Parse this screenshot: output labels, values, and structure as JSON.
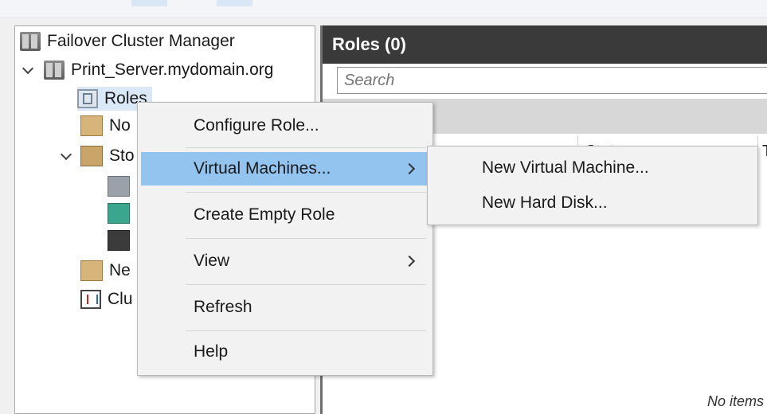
{
  "tree": {
    "items": [
      {
        "label": "Failover Cluster Manager",
        "icon": "cluster-manager-icon"
      },
      {
        "label": "Print_Server.mydomain.org",
        "icon": "cluster-icon"
      },
      {
        "label": "Roles",
        "icon": "roles-icon"
      },
      {
        "label": "No",
        "icon": "nodes-icon"
      },
      {
        "label": "Sto",
        "icon": "storage-icon"
      },
      {
        "label": "",
        "icon": "disks-icon"
      },
      {
        "label": "",
        "icon": "pools-icon"
      },
      {
        "label": "",
        "icon": "enclosures-icon"
      },
      {
        "label": "Ne",
        "icon": "networks-icon"
      },
      {
        "label": "Clu",
        "icon": "cluster-events-icon"
      }
    ]
  },
  "roles_pane": {
    "title": "Roles (0)",
    "search_placeholder": "Search",
    "columns": [
      "Status",
      "T"
    ],
    "empty_message": "No items"
  },
  "context_menu": {
    "items": [
      {
        "label": "Configure Role..."
      },
      {
        "label": "Virtual Machines...",
        "has_submenu": true,
        "highlighted": true
      },
      {
        "label": "Create Empty Role"
      },
      {
        "label": "View",
        "has_submenu": true
      },
      {
        "label": "Refresh"
      },
      {
        "label": "Help"
      }
    ]
  },
  "submenu": {
    "items": [
      {
        "label": "New Virtual Machine..."
      },
      {
        "label": "New Hard Disk..."
      }
    ]
  },
  "colors": {
    "highlight": "#93c3ef",
    "header_bg": "#3a3a3a",
    "selected_tree": "#dbe8f7"
  }
}
